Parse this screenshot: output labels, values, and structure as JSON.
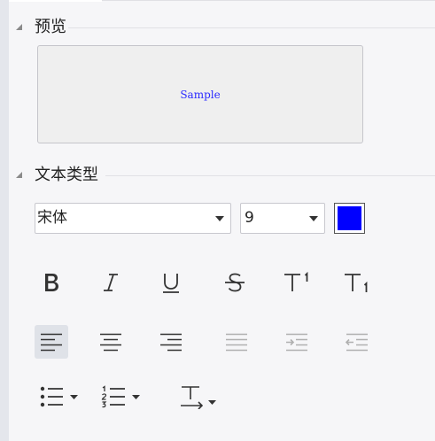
{
  "sections": {
    "preview": {
      "title": "预览",
      "sample_text": "Sample"
    },
    "text_type": {
      "title": "文本类型"
    }
  },
  "font": {
    "family": "宋体",
    "size": "9",
    "color": "#0000ff"
  },
  "format_buttons": [
    "bold-icon",
    "italic-icon",
    "underline-icon",
    "strikethrough-icon",
    "superscript-icon",
    "subscript-icon"
  ],
  "align_buttons": [
    "align-left-icon",
    "align-center-icon",
    "align-right-icon",
    "justify-icon",
    "indent-increase-icon",
    "indent-decrease-icon"
  ],
  "list_buttons": [
    "bullet-list-icon",
    "numbered-list-icon",
    "text-direction-icon"
  ],
  "active_alignment": "align-left",
  "colors": {
    "accent": "#0000ff",
    "icon": "#333333",
    "disabled_icon": "#b0b0b0",
    "active_bg": "#dfe2e8"
  }
}
